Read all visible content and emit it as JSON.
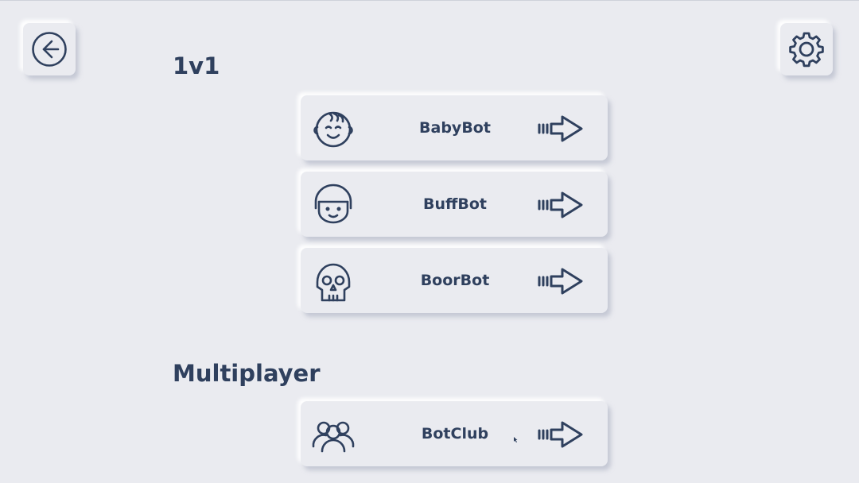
{
  "theme": {
    "background": "#eaebf0",
    "accent": "#2f405e"
  },
  "toolbar": {
    "back_icon": "arrow-left-circle-icon",
    "settings_icon": "gear-icon"
  },
  "sections": {
    "one_v_one": {
      "title": "1v1",
      "bots": [
        {
          "name": "BabyBot",
          "icon": "baby-face-icon",
          "action_icon": "arrow-right-icon"
        },
        {
          "name": "BuffBot",
          "icon": "helmet-face-icon",
          "action_icon": "arrow-right-icon"
        },
        {
          "name": "BoorBot",
          "icon": "skull-icon",
          "action_icon": "arrow-right-icon"
        }
      ]
    },
    "multiplayer": {
      "title": "Multiplayer",
      "bots": [
        {
          "name": "BotClub",
          "icon": "group-icon",
          "action_icon": "arrow-right-icon"
        }
      ]
    }
  }
}
